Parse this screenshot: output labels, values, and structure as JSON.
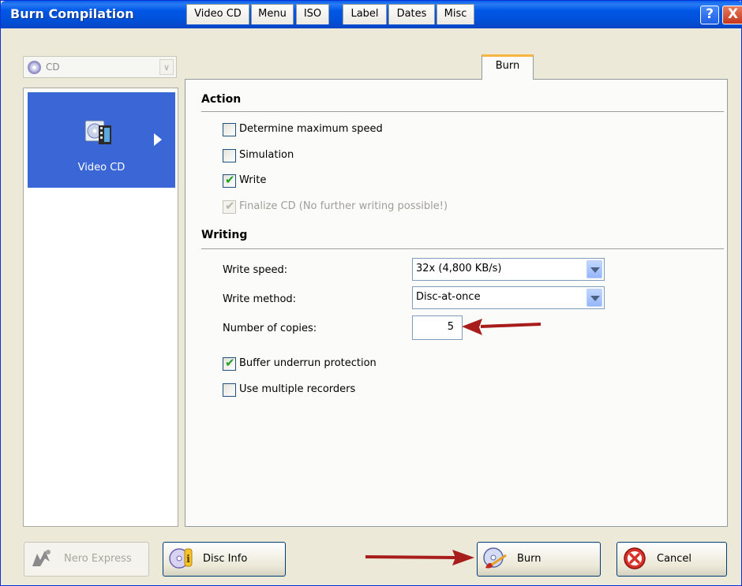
{
  "window": {
    "title": "Burn Compilation",
    "help_label": "?",
    "close_label": "X"
  },
  "disc_type": {
    "value": "CD"
  },
  "compilation_list": {
    "items": [
      {
        "label": "Video CD"
      }
    ]
  },
  "tabs": [
    "Video CD",
    "Menu",
    "ISO",
    "Label",
    "Dates",
    "Misc",
    "Burn"
  ],
  "active_tab": "Burn",
  "action_section": {
    "title": "Action",
    "options": [
      {
        "label": "Determine maximum speed",
        "checked": false,
        "enabled": true
      },
      {
        "label": "Simulation",
        "checked": false,
        "enabled": true
      },
      {
        "label": "Write",
        "checked": true,
        "enabled": true
      },
      {
        "label": "Finalize CD (No further writing possible!)",
        "checked": true,
        "enabled": false
      }
    ]
  },
  "writing_section": {
    "title": "Writing",
    "write_speed": {
      "label": "Write speed:",
      "value": "32x (4,800 KB/s)"
    },
    "write_method": {
      "label": "Write method:",
      "value": "Disc-at-once"
    },
    "copies": {
      "label": "Number of copies:",
      "value": "5"
    },
    "options": [
      {
        "label": "Buffer underrun protection",
        "checked": true,
        "enabled": true
      },
      {
        "label": "Use multiple recorders",
        "checked": false,
        "enabled": true
      }
    ]
  },
  "buttons": {
    "nero_express": "Nero Express",
    "disc_info": "Disc Info",
    "burn": "Burn",
    "cancel": "Cancel"
  },
  "colors": {
    "titlebar": "#0058e6",
    "selection": "#3a66d6",
    "active_tab_accent": "#f8b641",
    "annotation_arrow": "#a81c1c"
  }
}
